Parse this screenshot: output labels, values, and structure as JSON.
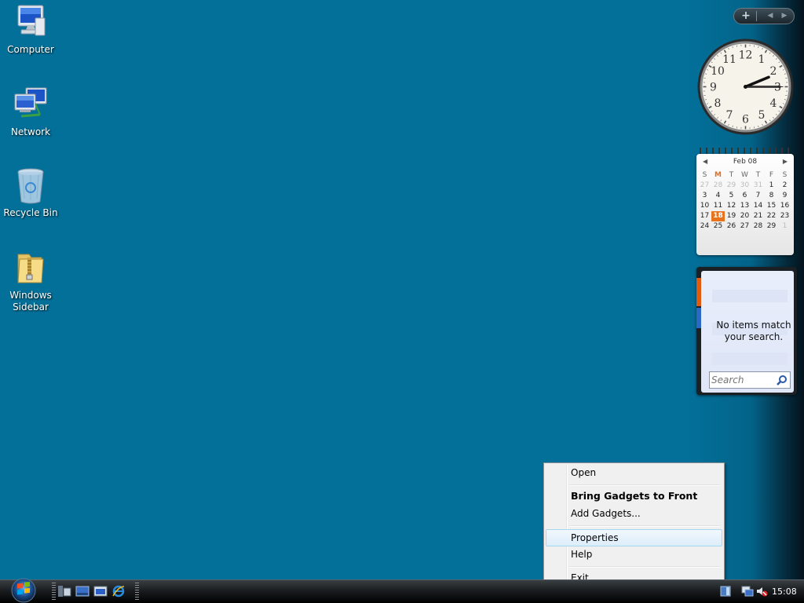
{
  "desktop": {
    "icons": [
      {
        "label": "Computer",
        "icon": "computer-icon"
      },
      {
        "label": "Network",
        "icon": "network-icon"
      },
      {
        "label": "Recycle Bin",
        "icon": "recycle-bin-icon"
      },
      {
        "label": "Windows\nSidebar",
        "icon": "zip-folder-icon"
      }
    ],
    "background_color": "#03709a"
  },
  "sidebar": {
    "controls": {
      "add": "+",
      "prev": "◀",
      "next": "▶"
    },
    "clock": {
      "hour": 2,
      "minute": 15,
      "second": 15,
      "numerals": [
        "12",
        "1",
        "2",
        "3",
        "4",
        "5",
        "6",
        "7",
        "8",
        "9",
        "10",
        "11"
      ]
    },
    "calendar": {
      "month_label": "Feb 08",
      "prev": "◀",
      "next": "▶",
      "weekdays": [
        "S",
        "M",
        "T",
        "W",
        "T",
        "F",
        "S"
      ],
      "highlight_weekday_index": 1,
      "weeks": [
        [
          "27",
          "28",
          "29",
          "30",
          "31",
          "1",
          "2"
        ],
        [
          "3",
          "4",
          "5",
          "6",
          "7",
          "8",
          "9"
        ],
        [
          "10",
          "11",
          "12",
          "13",
          "14",
          "15",
          "16"
        ],
        [
          "17",
          "18",
          "19",
          "20",
          "21",
          "22",
          "23"
        ],
        [
          "24",
          "25",
          "26",
          "27",
          "28",
          "29",
          "1"
        ]
      ],
      "today": "18"
    },
    "feed": {
      "message": "No items match your search.",
      "search_placeholder": "Search"
    }
  },
  "context_menu": {
    "items": [
      {
        "label": "Open",
        "bold": false
      },
      {
        "label": "Bring Gadgets to Front",
        "bold": true
      },
      {
        "label": "Add Gadgets...",
        "bold": false
      },
      {
        "label": "Properties",
        "bold": false,
        "highlighted": true
      },
      {
        "label": "Help",
        "bold": false
      },
      {
        "label": "Exit",
        "bold": false
      }
    ]
  },
  "taskbar": {
    "start_icon": "windows-start-orb-icon",
    "quick_launch": [
      "switch-windows-icon",
      "show-desktop-icon",
      "window-icon",
      "internet-explorer-icon"
    ],
    "tray": {
      "icons": [
        "sidebar-tray-icon",
        "network-tray-icon",
        "volume-muted-icon"
      ],
      "time": "15:08"
    }
  }
}
